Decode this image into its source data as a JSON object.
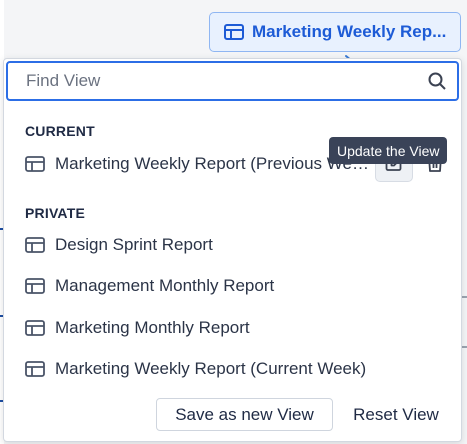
{
  "view_button": {
    "label": "Marketing Weekly Rep...",
    "icon": "table-icon"
  },
  "search": {
    "placeholder": "Find View",
    "value": "",
    "icon": "search-icon"
  },
  "current": {
    "heading": "CURRENT",
    "item": {
      "label": "Marketing Weekly Report (Previous Week)",
      "icon": "table-icon"
    },
    "edit_icon": "edit-icon",
    "delete_icon": "trash-icon",
    "tooltip": "Update the View"
  },
  "private": {
    "heading": "PRIVATE",
    "items": [
      {
        "label": "Design Sprint Report",
        "icon": "table-icon"
      },
      {
        "label": "Management Monthly Report",
        "icon": "table-icon"
      },
      {
        "label": "Marketing Monthly Report",
        "icon": "table-icon"
      },
      {
        "label": "Marketing Weekly Report (Current Week)",
        "icon": "table-icon"
      }
    ]
  },
  "footer": {
    "save_label": "Save as new View",
    "reset_label": "Reset View"
  },
  "colors": {
    "accent": "#2c6ee6",
    "accent_bg": "#e8f1fe",
    "tooltip_bg": "#3a4358",
    "annotation_arrow": "#3a7bd5"
  }
}
